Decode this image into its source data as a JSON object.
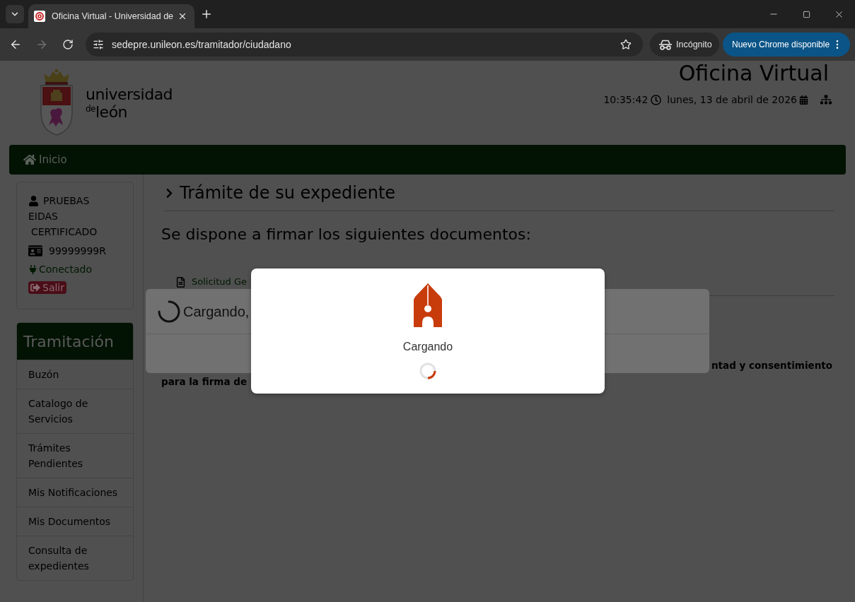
{
  "browser": {
    "tabs": [
      {
        "title": "Oficina Virtual - Universidad de",
        "selected": true
      }
    ],
    "forward_disabled": true,
    "address": "sedepre.unileon.es/tramitador/ciudadano",
    "incognito": "Incógnito",
    "update_button": "Nuevo Chrome disponible"
  },
  "header": {
    "logo": {
      "line1": "universidad",
      "prefix": "de",
      "line2": "león"
    },
    "title": "Oficina Virtual",
    "time": "10:35:42",
    "date": "lunes, 13 de abril de 2026"
  },
  "navbar": {
    "items": [
      {
        "label": "Inicio"
      }
    ]
  },
  "user": {
    "name_lines": [
      "PRUEBAS",
      "EIDAS",
      "CERTIFICADO"
    ],
    "id": "99999999R",
    "status": "Conectado",
    "logout": "Salir"
  },
  "menu": {
    "title": "Tramitación",
    "items": [
      {
        "label": "Buzón"
      },
      {
        "label": "Catalogo de Servicios"
      },
      {
        "label": "Trámites Pendientes"
      },
      {
        "label": "Mis Notificaciones"
      },
      {
        "label": "Mis Documentos"
      },
      {
        "label": "Consulta de expedientes"
      }
    ]
  },
  "main": {
    "heading": "Trámite de su expediente",
    "intro": "Se dispone a firmar los siguientes documentos:",
    "documents": [
      {
        "name": "Solicitud Ge"
      }
    ],
    "notice_fragments": [
      "ntad y consentimiento",
      "para la firma de"
    ]
  },
  "loading_dialog": {
    "text": "Cargando,"
  },
  "signing_modal": {
    "text": "Cargando"
  }
}
